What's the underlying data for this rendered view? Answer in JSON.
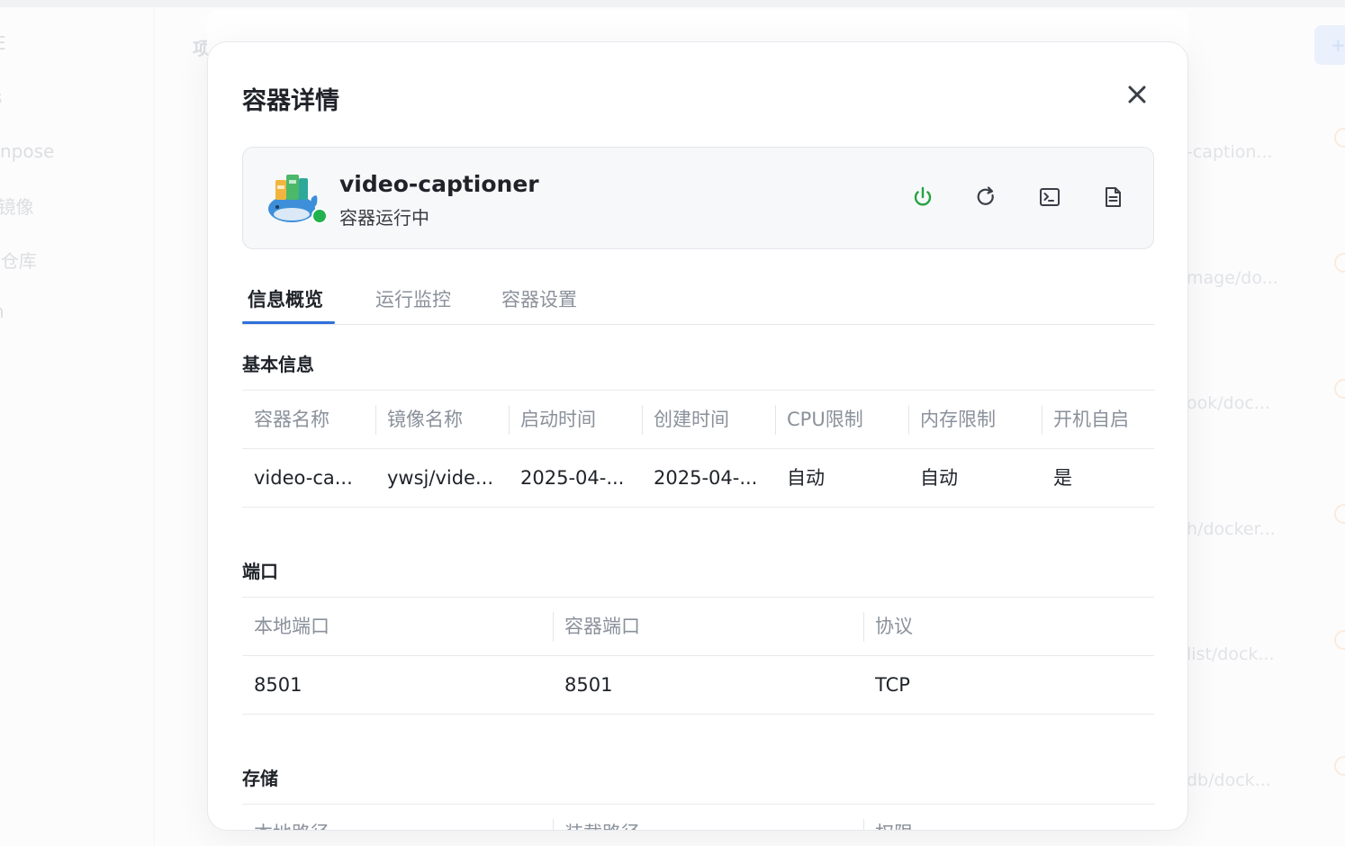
{
  "background": {
    "sidebar_items": [
      "E",
      "s",
      "npose",
      "l镜像",
      "|仓库",
      "h"
    ],
    "page_title": "项",
    "add_button": "+",
    "row_texts": [
      "-caption...",
      "mage/do...",
      "ook/doc...",
      "h/docker...",
      "list/dock...",
      "db/dock..."
    ]
  },
  "modal": {
    "title": "容器详情",
    "container": {
      "name": "video-captioner",
      "status": "容器运行中",
      "status_color": "#23b14d"
    },
    "tabs": [
      {
        "label": "信息概览"
      },
      {
        "label": "运行监控"
      },
      {
        "label": "容器设置"
      }
    ],
    "basic": {
      "title": "基本信息",
      "headers": [
        "容器名称",
        "镜像名称",
        "启动时间",
        "创建时间",
        "CPU限制",
        "内存限制",
        "开机自启"
      ],
      "row": [
        "video-ca...",
        "ywsj/vide...",
        "2025-04-...",
        "2025-04-...",
        "自动",
        "自动",
        "是"
      ]
    },
    "ports": {
      "title": "端口",
      "headers": [
        "本地端口",
        "容器端口",
        "协议"
      ],
      "row": [
        "8501",
        "8501",
        "TCP"
      ]
    },
    "storage": {
      "title": "存储",
      "headers": [
        "本地路径",
        "装载路径",
        "权限"
      ]
    }
  },
  "colors": {
    "accent": "#2f6fdc",
    "power_icon": "#23b14d",
    "status_dot": "#23b14d"
  },
  "icons": [
    "power-icon",
    "restart-icon",
    "terminal-icon",
    "log-icon",
    "close-icon"
  ]
}
